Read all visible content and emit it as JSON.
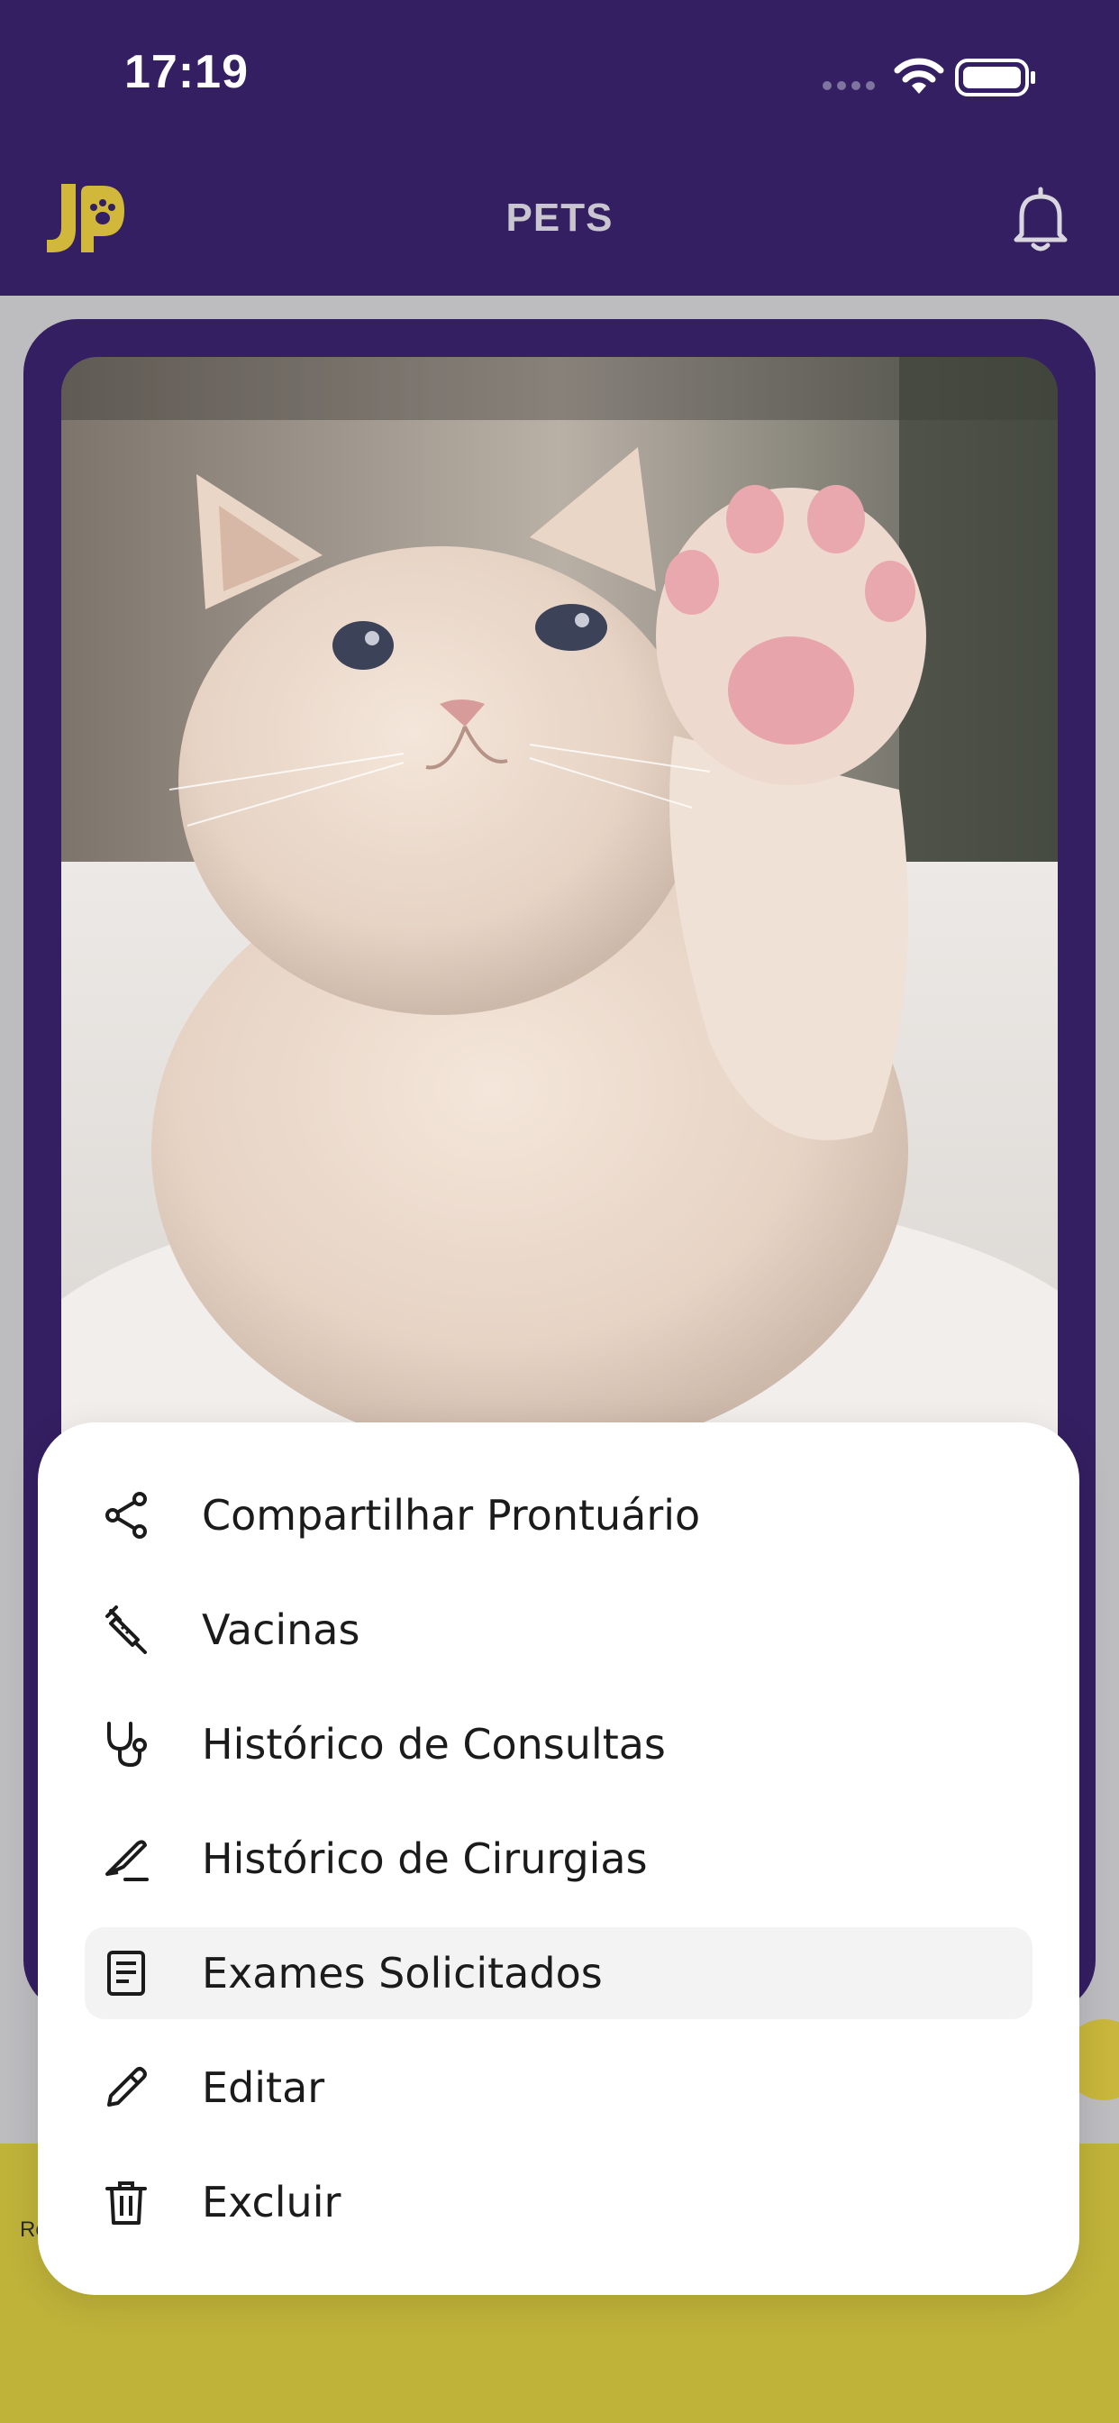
{
  "status_bar": {
    "time": "17:19"
  },
  "header": {
    "title": "PETS"
  },
  "menu": {
    "items": [
      {
        "label": "Compartilhar Prontuário",
        "icon": "share-icon"
      },
      {
        "label": "Vacinas",
        "icon": "syringe-icon"
      },
      {
        "label": "Histórico de Consultas",
        "icon": "stethoscope-icon"
      },
      {
        "label": "Histórico de Cirurgias",
        "icon": "scalpel-icon"
      },
      {
        "label": "Exames Solicitados",
        "icon": "document-icon"
      },
      {
        "label": "Editar",
        "icon": "pencil-icon"
      },
      {
        "label": "Excluir",
        "icon": "trash-icon"
      }
    ],
    "highlighted_index": 4
  },
  "bottom": {
    "partial_text": "Re"
  },
  "colors": {
    "brand_purple": "#341f62",
    "brand_gold": "#c0b33a",
    "logo_gold": "#d1b83a"
  }
}
